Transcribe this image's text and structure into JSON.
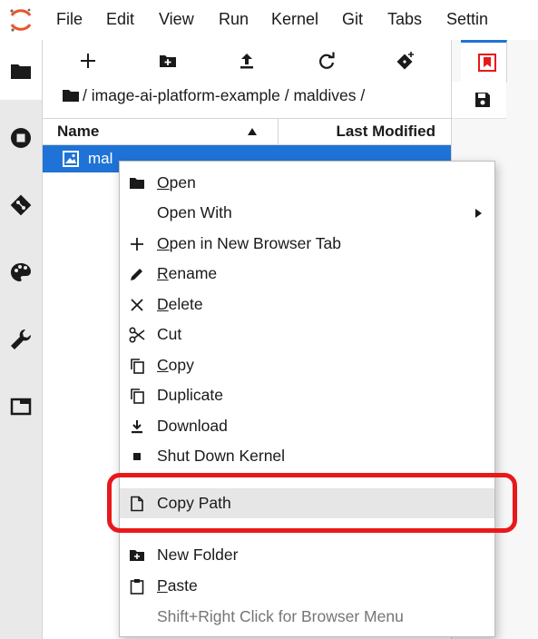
{
  "menubar": {
    "items": [
      "File",
      "Edit",
      "View",
      "Run",
      "Kernel",
      "Git",
      "Tabs",
      "Settin"
    ]
  },
  "activitybar": {
    "icons": [
      "folder-icon",
      "running-stop-icon",
      "git-icon",
      "palette-icon",
      "wrench-icon",
      "tabs-window-icon"
    ]
  },
  "filebrowser": {
    "toolbar_icons": [
      "new-launcher-plus-icon",
      "new-folder-icon",
      "upload-icon",
      "refresh-icon",
      "git-clone-icon"
    ],
    "breadcrumb": "/ image-ai-platform-example / maldives /",
    "columns": {
      "name": "Name",
      "modified": "Last Modified"
    },
    "sort_direction": "ascending",
    "selected_file": "mal",
    "selected_color": "#1f73d6"
  },
  "context_menu": {
    "items": [
      {
        "mnemonic": "O",
        "rest": "pen",
        "icon": "folder-icon"
      },
      {
        "mnemonic": "",
        "rest": "Open With",
        "icon": "",
        "submenu": true
      },
      {
        "mnemonic": "O",
        "rest": "pen in New Browser Tab",
        "icon": "plus-icon"
      },
      {
        "mnemonic": "R",
        "rest": "ename",
        "icon": "pencil-icon"
      },
      {
        "mnemonic": "D",
        "rest": "elete",
        "icon": "close-x-icon"
      },
      {
        "mnemonic": "",
        "rest": "Cut",
        "icon": "scissors-icon"
      },
      {
        "mnemonic": "C",
        "rest": "opy",
        "icon": "copy-icon"
      },
      {
        "mnemonic": "",
        "rest": "Duplicate",
        "icon": "duplicate-icon"
      },
      {
        "mnemonic": "",
        "rest": "Download",
        "icon": "download-icon"
      },
      {
        "mnemonic": "",
        "rest": "Shut Down Kernel",
        "icon": "stop-square-icon"
      },
      {
        "mnemonic": "",
        "rest": "Copy Path",
        "icon": "file-icon",
        "highlighted": true
      },
      {
        "mnemonic": "",
        "rest": "New Folder",
        "icon": "new-folder-icon"
      },
      {
        "mnemonic": "P",
        "rest": "aste",
        "icon": "clipboard-icon"
      },
      {
        "mnemonic": "",
        "rest": "Shift+Right Click for Browser Menu",
        "icon": "",
        "muted": true
      }
    ]
  },
  "annotation": {
    "color": "#e8191b",
    "target": "Copy Path"
  }
}
